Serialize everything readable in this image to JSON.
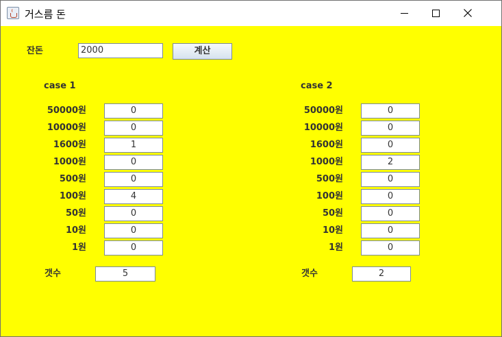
{
  "window": {
    "title": "거스름 돈"
  },
  "top": {
    "balance_label": "잔돈",
    "balance_value": "2000",
    "calc_label": "계산"
  },
  "case1": {
    "title": "case 1",
    "rows": [
      {
        "label": "50000원",
        "value": "0"
      },
      {
        "label": "10000원",
        "value": "0"
      },
      {
        "label": "1600원",
        "value": "1"
      },
      {
        "label": "1000원",
        "value": "0"
      },
      {
        "label": "500원",
        "value": "0"
      },
      {
        "label": "100원",
        "value": "4"
      },
      {
        "label": "50원",
        "value": "0"
      },
      {
        "label": "10원",
        "value": "0"
      },
      {
        "label": "1원",
        "value": "0"
      }
    ],
    "count_label": "갯수",
    "count_value": "5"
  },
  "case2": {
    "title": "case 2",
    "rows": [
      {
        "label": "50000원",
        "value": "0"
      },
      {
        "label": "10000원",
        "value": "0"
      },
      {
        "label": "1600원",
        "value": "0"
      },
      {
        "label": "1000원",
        "value": "2"
      },
      {
        "label": "500원",
        "value": "0"
      },
      {
        "label": "100원",
        "value": "0"
      },
      {
        "label": "50원",
        "value": "0"
      },
      {
        "label": "10원",
        "value": "0"
      },
      {
        "label": "1원",
        "value": "0"
      }
    ],
    "count_label": "갯수",
    "count_value": "2"
  },
  "colors": {
    "background": "#ffff00",
    "text": "#333333"
  }
}
